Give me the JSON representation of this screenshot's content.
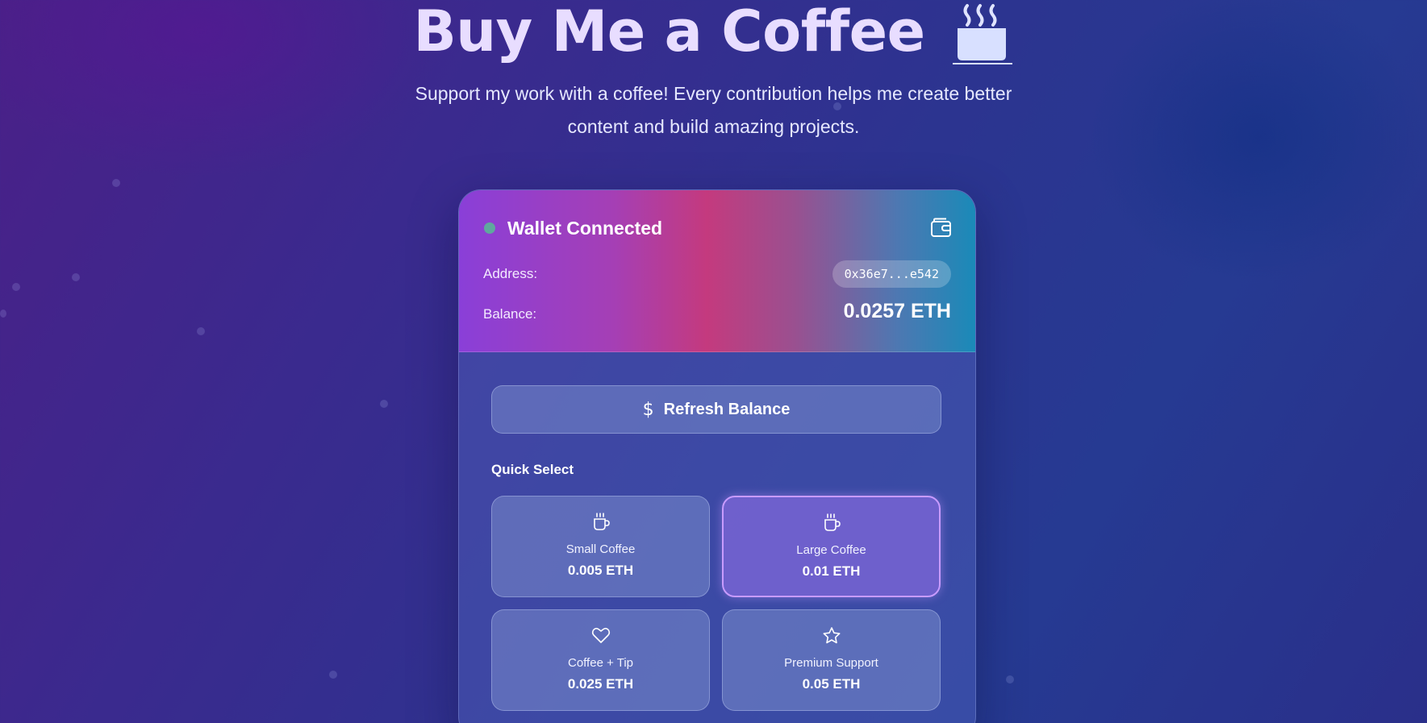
{
  "header": {
    "title": "Buy Me a Coffee",
    "title_icon": "hot-coffee-icon",
    "subtitle_line1": "Support my work with a coffee! Every contribution helps me create better",
    "subtitle_line2": "content and build amazing projects."
  },
  "wallet": {
    "status": "Wallet Connected",
    "status_color": "#5fa89e",
    "icon": "wallet-icon",
    "address_label": "Address:",
    "address": "0x36e7...e542",
    "balance_label": "Balance:",
    "balance": "0.0257 ETH"
  },
  "actions": {
    "refresh_label": "Refresh Balance",
    "refresh_icon": "dollar-icon"
  },
  "quick_select": {
    "label": "Quick Select",
    "options": [
      {
        "name": "Small Coffee",
        "price": "0.005 ETH",
        "icon": "coffee-icon",
        "selected": false
      },
      {
        "name": "Large Coffee",
        "price": "0.01 ETH",
        "icon": "coffee-icon",
        "selected": true
      },
      {
        "name": "Coffee + Tip",
        "price": "0.025 ETH",
        "icon": "heart-icon",
        "selected": false
      },
      {
        "name": "Premium Support",
        "price": "0.05 ETH",
        "icon": "star-icon",
        "selected": false
      }
    ]
  },
  "colors": {
    "accent": "#c89bff",
    "header_gradient": [
      "#8a3fd8",
      "#c43a7e",
      "#1a8ab8"
    ]
  }
}
